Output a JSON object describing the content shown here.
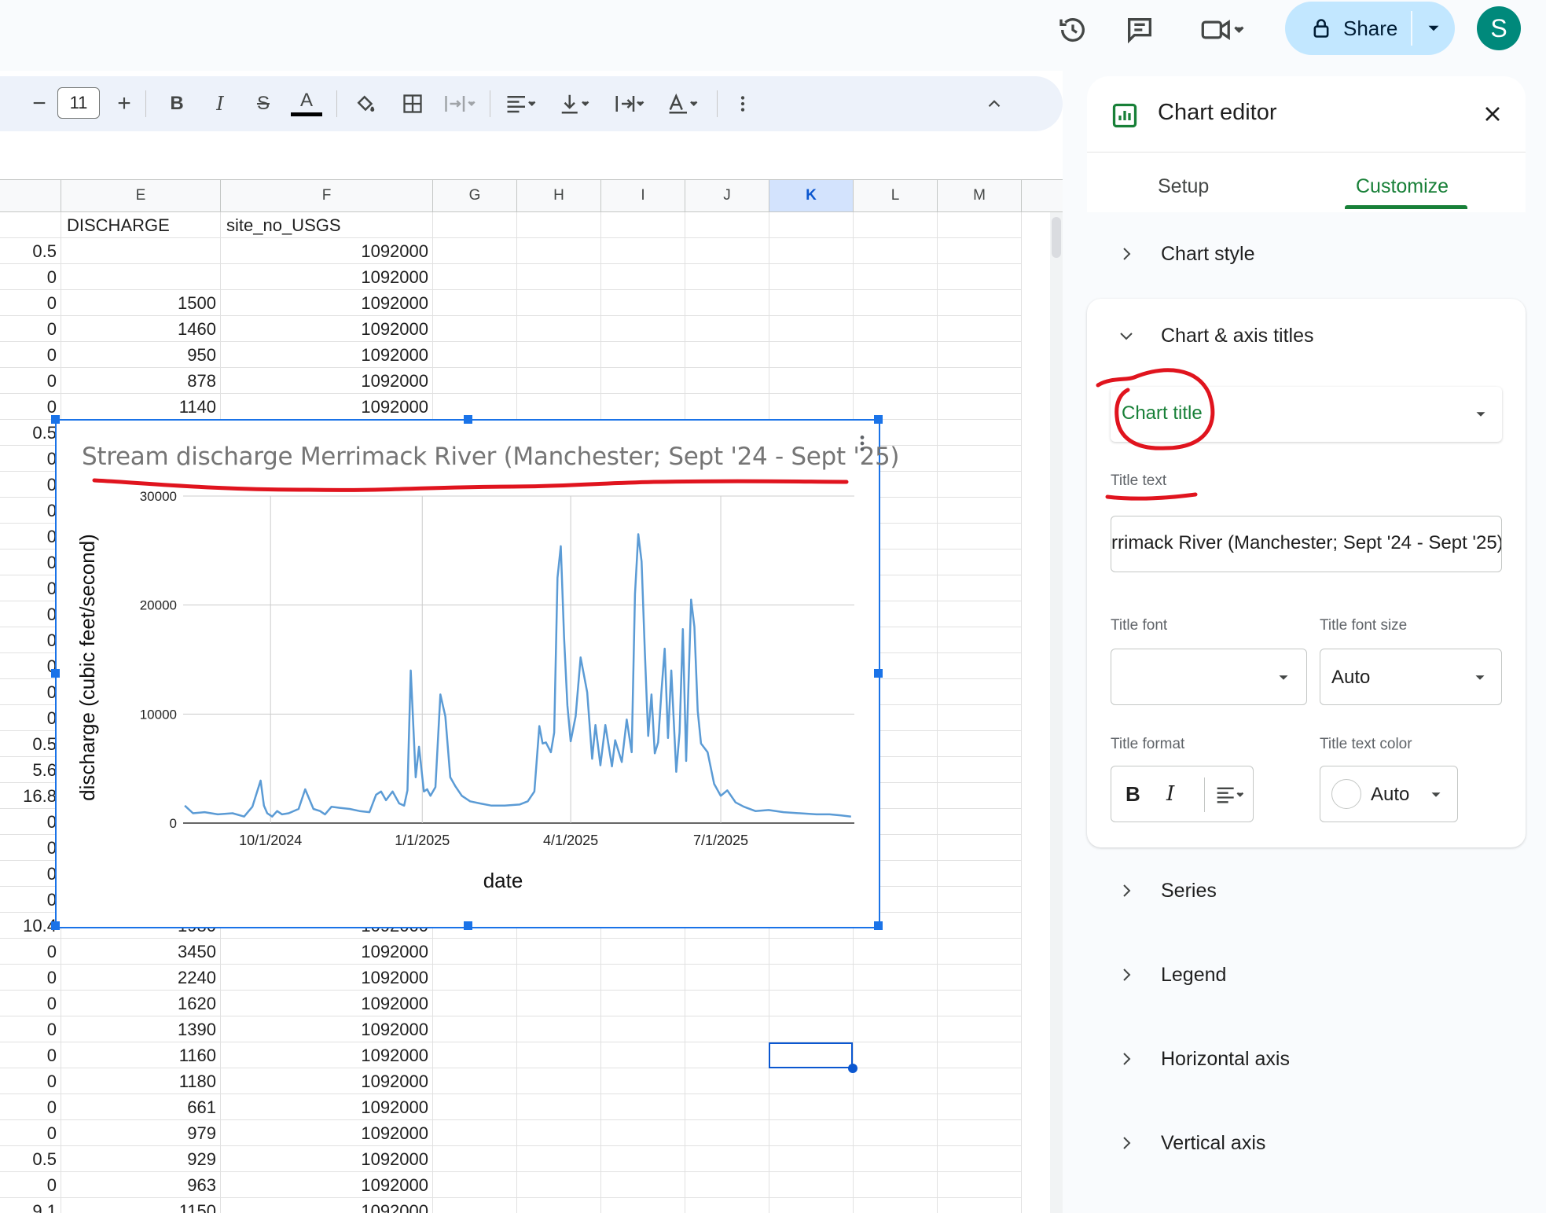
{
  "topbar": {
    "share_label": "Share",
    "avatar_letter": "S"
  },
  "toolbar": {
    "font_size": "11",
    "decrease": "−",
    "increase": "+",
    "bold": "B",
    "italic": "I",
    "strike": "S",
    "text_color": "A"
  },
  "columns": [
    "E",
    "F",
    "G",
    "H",
    "I",
    "J",
    "K",
    "L",
    "M"
  ],
  "selected_column": "K",
  "rows": [
    {
      "d": "",
      "e": "DISCHARGE",
      "f": "site_no_USGS"
    },
    {
      "d": "0.5",
      "e": "",
      "f": "1092000"
    },
    {
      "d": "0",
      "e": "",
      "f": "1092000"
    },
    {
      "d": "0",
      "e": "1500",
      "f": "1092000"
    },
    {
      "d": "0",
      "e": "1460",
      "f": "1092000"
    },
    {
      "d": "0",
      "e": "950",
      "f": "1092000"
    },
    {
      "d": "0",
      "e": "878",
      "f": "1092000"
    },
    {
      "d": "0",
      "e": "1140",
      "f": "1092000"
    },
    {
      "d": "0.5",
      "e": "",
      "f": ""
    },
    {
      "d": "0",
      "e": "",
      "f": ""
    },
    {
      "d": "0",
      "e": "",
      "f": ""
    },
    {
      "d": "0",
      "e": "",
      "f": ""
    },
    {
      "d": "0",
      "e": "",
      "f": ""
    },
    {
      "d": "0",
      "e": "",
      "f": ""
    },
    {
      "d": "0",
      "e": "",
      "f": ""
    },
    {
      "d": "0",
      "e": "",
      "f": ""
    },
    {
      "d": "0",
      "e": "",
      "f": ""
    },
    {
      "d": "0",
      "e": "",
      "f": ""
    },
    {
      "d": "0",
      "e": "",
      "f": ""
    },
    {
      "d": "0",
      "e": "",
      "f": ""
    },
    {
      "d": "0.5",
      "e": "",
      "f": ""
    },
    {
      "d": "5.6",
      "e": "",
      "f": ""
    },
    {
      "d": "16.8",
      "e": "",
      "f": ""
    },
    {
      "d": "0",
      "e": "",
      "f": ""
    },
    {
      "d": "0",
      "e": "",
      "f": ""
    },
    {
      "d": "0",
      "e": "",
      "f": ""
    },
    {
      "d": "0",
      "e": "",
      "f": ""
    },
    {
      "d": "10.4",
      "e": "1980",
      "f": "1092000"
    },
    {
      "d": "0",
      "e": "3450",
      "f": "1092000"
    },
    {
      "d": "0",
      "e": "2240",
      "f": "1092000"
    },
    {
      "d": "0",
      "e": "1620",
      "f": "1092000"
    },
    {
      "d": "0",
      "e": "1390",
      "f": "1092000"
    },
    {
      "d": "0",
      "e": "1160",
      "f": "1092000"
    },
    {
      "d": "0",
      "e": "1180",
      "f": "1092000"
    },
    {
      "d": "0",
      "e": "661",
      "f": "1092000"
    },
    {
      "d": "0",
      "e": "979",
      "f": "1092000"
    },
    {
      "d": "0.5",
      "e": "929",
      "f": "1092000"
    },
    {
      "d": "0",
      "e": "963",
      "f": "1092000"
    },
    {
      "d": "9.1",
      "e": "1150",
      "f": "1092000"
    }
  ],
  "chart_data": {
    "type": "line",
    "title": "Stream discharge Merrimack River (Manchester; Sept '24 - Sept '25)",
    "xlabel": "date",
    "ylabel": "discharge (cubic feet/second)",
    "ylim": [
      0,
      30000
    ],
    "yticks": [
      "0",
      "10000",
      "20000",
      "30000"
    ],
    "xticks": [
      "10/1/2024",
      "1/1/2025",
      "4/1/2025",
      "7/1/2025"
    ],
    "xlim": [
      "2024-08-09",
      "2025-09-20"
    ],
    "grid": true,
    "legend": "none",
    "color": "#5b9bd5",
    "series": [
      {
        "x": [
          "2024-08-10",
          "2024-08-15",
          "2024-08-22",
          "2024-08-30",
          "2024-09-08",
          "2024-09-15",
          "2024-09-20",
          "2024-09-25",
          "2024-09-27",
          "2024-09-29",
          "2024-10-02",
          "2024-10-05",
          "2024-10-08",
          "2024-10-12",
          "2024-10-18",
          "2024-10-22",
          "2024-10-27",
          "2024-10-31",
          "2024-11-03",
          "2024-11-07",
          "2024-11-12",
          "2024-11-18",
          "2024-11-24",
          "2024-11-30",
          "2024-12-04",
          "2024-12-07",
          "2024-12-10",
          "2024-12-14",
          "2024-12-18",
          "2024-12-21",
          "2024-12-23",
          "2024-12-25",
          "2024-12-28",
          "2024-12-30",
          "2025-01-02",
          "2025-01-04",
          "2025-01-06",
          "2025-01-09",
          "2025-01-12",
          "2025-01-15",
          "2025-01-18",
          "2025-01-21",
          "2025-01-25",
          "2025-01-30",
          "2025-02-05",
          "2025-02-12",
          "2025-02-20",
          "2025-03-01",
          "2025-03-06",
          "2025-03-10",
          "2025-03-13",
          "2025-03-15",
          "2025-03-17",
          "2025-03-20",
          "2025-03-22",
          "2025-03-24",
          "2025-03-26",
          "2025-03-28",
          "2025-03-30",
          "2025-04-01",
          "2025-04-04",
          "2025-04-07",
          "2025-04-11",
          "2025-04-14",
          "2025-04-16",
          "2025-04-19",
          "2025-04-22",
          "2025-04-26",
          "2025-04-28",
          "2025-05-02",
          "2025-05-05",
          "2025-05-08",
          "2025-05-10",
          "2025-05-12",
          "2025-05-14",
          "2025-05-16",
          "2025-05-18",
          "2025-05-20",
          "2025-05-22",
          "2025-05-24",
          "2025-05-26",
          "2025-05-28",
          "2025-05-30",
          "2025-06-01",
          "2025-06-04",
          "2025-06-06",
          "2025-06-08",
          "2025-06-10",
          "2025-06-13",
          "2025-06-15",
          "2025-06-17",
          "2025-06-19",
          "2025-06-23",
          "2025-06-27",
          "2025-07-01",
          "2025-07-05",
          "2025-07-10",
          "2025-07-15",
          "2025-07-22",
          "2025-07-30",
          "2025-08-08",
          "2025-08-18",
          "2025-08-28",
          "2025-09-05",
          "2025-09-12",
          "2025-09-18"
        ],
        "values": [
          1600,
          900,
          1000,
          800,
          900,
          600,
          1500,
          3900,
          1600,
          900,
          600,
          1100,
          800,
          900,
          1300,
          3100,
          1300,
          1100,
          800,
          1500,
          1400,
          1300,
          1100,
          1000,
          2600,
          2900,
          2100,
          2900,
          1800,
          1600,
          3000,
          14000,
          4200,
          7000,
          2900,
          3100,
          2500,
          3300,
          11800,
          9800,
          4200,
          3400,
          2500,
          2000,
          1800,
          1600,
          1600,
          1700,
          2000,
          2900,
          8900,
          7300,
          7400,
          6500,
          8300,
          22500,
          25400,
          17000,
          10800,
          7500,
          9800,
          15200,
          12000,
          5900,
          9000,
          5300,
          9000,
          5200,
          7600,
          5600,
          9500,
          6500,
          21000,
          26500,
          24000,
          15600,
          8000,
          11800,
          6400,
          7400,
          12000,
          16000,
          7800,
          14000,
          4700,
          8300,
          17800,
          5700,
          20500,
          18000,
          10300,
          7300,
          6500,
          3600,
          2500,
          3000,
          1900,
          1500,
          1100,
          1200,
          1000,
          900,
          800,
          800,
          700,
          600
        ]
      }
    ]
  },
  "editor": {
    "title": "Chart editor",
    "tab_setup": "Setup",
    "tab_customize": "Customize",
    "sections": {
      "chart_style": "Chart style",
      "axis_titles": "Chart & axis titles",
      "series": "Series",
      "legend": "Legend",
      "horizontal_axis": "Horizontal axis",
      "vertical_axis": "Vertical axis"
    },
    "title_type_value": "Chart title",
    "title_text_label": "Title text",
    "title_text_value": "rrimack River (Manchester; Sept '24 - Sept '25)",
    "title_font_label": "Title font",
    "title_font_value": "",
    "title_font_size_label": "Title font size",
    "title_font_size_value": "Auto",
    "title_format_label": "Title format",
    "title_text_color_label": "Title text color",
    "title_text_color_value": "Auto",
    "format_bold": "B",
    "format_italic": "I"
  },
  "colors": {
    "accent_green": "#188038",
    "selection_blue": "#0b57d0",
    "share_bg": "#c2e7ff",
    "annotation_red": "#e0141e"
  }
}
